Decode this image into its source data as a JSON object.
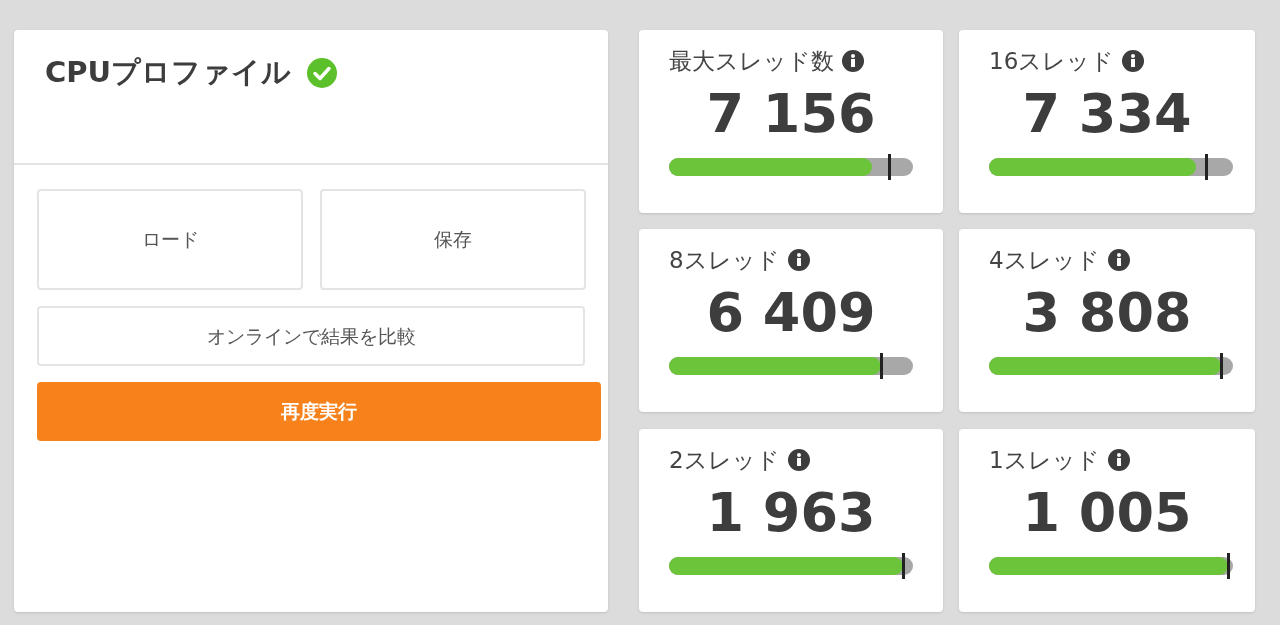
{
  "profile": {
    "title": "CPUプロファイル",
    "verified": true,
    "buttons": [
      {
        "label": "ロード",
        "kind": "outline"
      },
      {
        "label": "保存",
        "kind": "outline"
      },
      {
        "label": "オンラインで結果を比較",
        "kind": "wide"
      },
      {
        "label": "再度実行",
        "kind": "primary"
      }
    ]
  },
  "scores": [
    {
      "label": "最大スレッド数",
      "value": "7 156",
      "level": 0.83,
      "reference": {
        "level": 0.9
      }
    },
    {
      "label": "16スレッド",
      "value": "7 334",
      "level": 0.85,
      "reference": {
        "level": 0.89
      }
    },
    {
      "label": "8スレッド",
      "value": "6 409",
      "level": 0.87,
      "reference": {
        "level": 0.87
      }
    },
    {
      "label": "4スレッド",
      "value": "3 808",
      "level": 0.95,
      "reference": {
        "level": 0.95
      }
    },
    {
      "label": "2スレッド",
      "value": "1 963",
      "level": 0.96,
      "reference": {
        "level": 0.96
      }
    },
    {
      "label": "1スレッド",
      "value": "1 005",
      "level": 0.98,
      "reference": {
        "level": 0.98
      }
    }
  ]
}
